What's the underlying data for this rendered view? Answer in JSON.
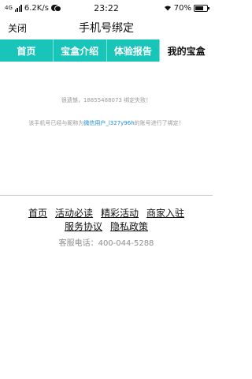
{
  "status_bar": {
    "network": "4G",
    "speed": "6.2K/s",
    "time": "23:22",
    "battery": "70%",
    "battery_level": 0.7,
    "icons": [
      "signal-icon",
      "wechat-icon",
      "wifi-icon",
      "battery-icon"
    ]
  },
  "nav": {
    "close_label": "关闭",
    "title": "手机号绑定"
  },
  "tabs": [
    {
      "label": "首页",
      "active": false
    },
    {
      "label": "宝盒介绍",
      "active": false
    },
    {
      "label": "体验报告",
      "active": false
    },
    {
      "label": "我的宝盒",
      "active": true
    }
  ],
  "content": {
    "fail_message": "很遗憾，18855488073 绑定失败！",
    "info_prefix": "该手机号已经与昵称为",
    "info_user": "微信用户_l327y96h",
    "info_suffix": "的账号进行了绑定！"
  },
  "footer": {
    "links": [
      "首页",
      "活动必读",
      "精彩活动",
      "商家入驻",
      "服务协议",
      "隐私政策"
    ],
    "service_phone": "客服电话：400-044-5288"
  },
  "colors": {
    "accent": "#19c5b9",
    "link_blue": "#1a8bd6"
  }
}
